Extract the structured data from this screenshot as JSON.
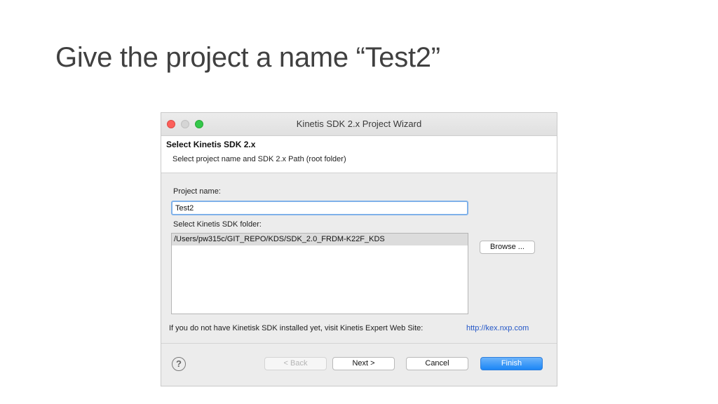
{
  "slide": {
    "title": "Give the project a name “Test2”"
  },
  "window": {
    "title": "Kinetis SDK 2.x Project Wizard"
  },
  "header": {
    "title": "Select Kinetis SDK 2.x",
    "description": "Select project name and SDK 2.x Path (root folder)"
  },
  "form": {
    "project_name_label": "Project name:",
    "project_name_value": "Test2",
    "sdk_folder_label": "Select Kinetis SDK folder:",
    "sdk_folders": [
      "/Users/pw315c/GIT_REPO/KDS/SDK_2.0_FRDM-K22F_KDS"
    ],
    "browse_label": "Browse ..."
  },
  "info": {
    "text": "If you do not have Kinetisk SDK installed yet, visit Kinetis Expert Web Site:",
    "link": "http://kex.nxp.com"
  },
  "buttons": {
    "help": "?",
    "back": "< Back",
    "next": "Next >",
    "cancel": "Cancel",
    "finish": "Finish"
  },
  "colors": {
    "accent": "#1b86f6",
    "close": "#fc605b",
    "zoom": "#34c84a",
    "link": "#2457c7",
    "focus": "#7fb1e9"
  }
}
